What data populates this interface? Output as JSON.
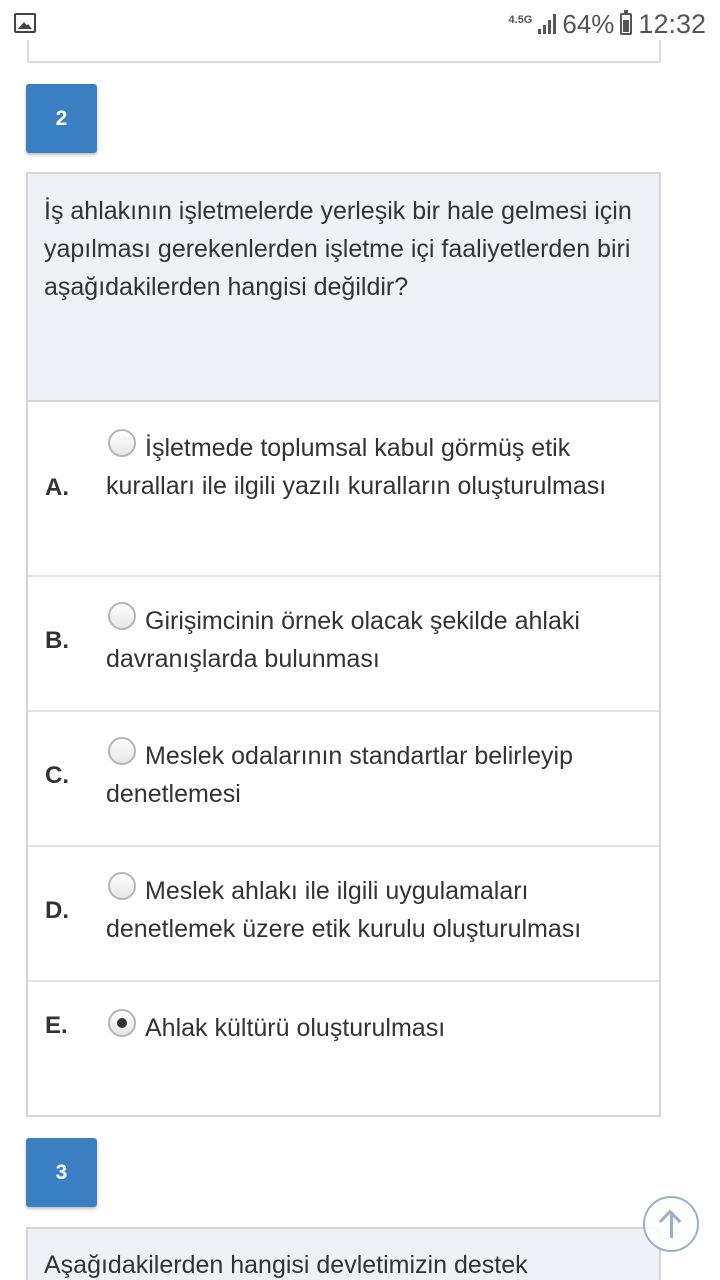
{
  "status_bar": {
    "network": "4.5G",
    "battery_percent": "64%",
    "battery_level": 0.64,
    "time": "12:32"
  },
  "questions": [
    {
      "number": "2",
      "text": "İş ahlakının işletmelerde yerleşik bir hale gelmesi için yapılması gerekenlerden işletme içi faaliyetlerden biri aşağıdakilerden hangisi değildir?",
      "options": [
        {
          "letter": "A.",
          "text": "İşletmede toplumsal kabul görmüş etik kuralları ile ilgili yazılı kuralların oluşturulması",
          "selected": false
        },
        {
          "letter": "B.",
          "text": "Girişimcinin örnek olacak şekilde ahlaki davranışlarda bulunması",
          "selected": false
        },
        {
          "letter": "C.",
          "text": "Meslek odalarının standartlar belirleyip denetlemesi",
          "selected": false
        },
        {
          "letter": "D.",
          "text": "Meslek ahlakı ile ilgili uygulamaları denetlemek üzere etik kurulu oluşturulması",
          "selected": false
        },
        {
          "letter": "E.",
          "text": "Ahlak kültürü oluşturulması",
          "selected": true
        }
      ]
    },
    {
      "number": "3",
      "text": "Aşağıdakilerden hangisi devletimizin destek"
    }
  ],
  "colors": {
    "badge": "#3a7fc2",
    "question_bg": "#eff1f6",
    "border": "#d6d6d6"
  },
  "icons": [
    "gallery-icon",
    "signal-icon",
    "battery-icon",
    "radio-icon",
    "arrow-up-icon"
  ]
}
